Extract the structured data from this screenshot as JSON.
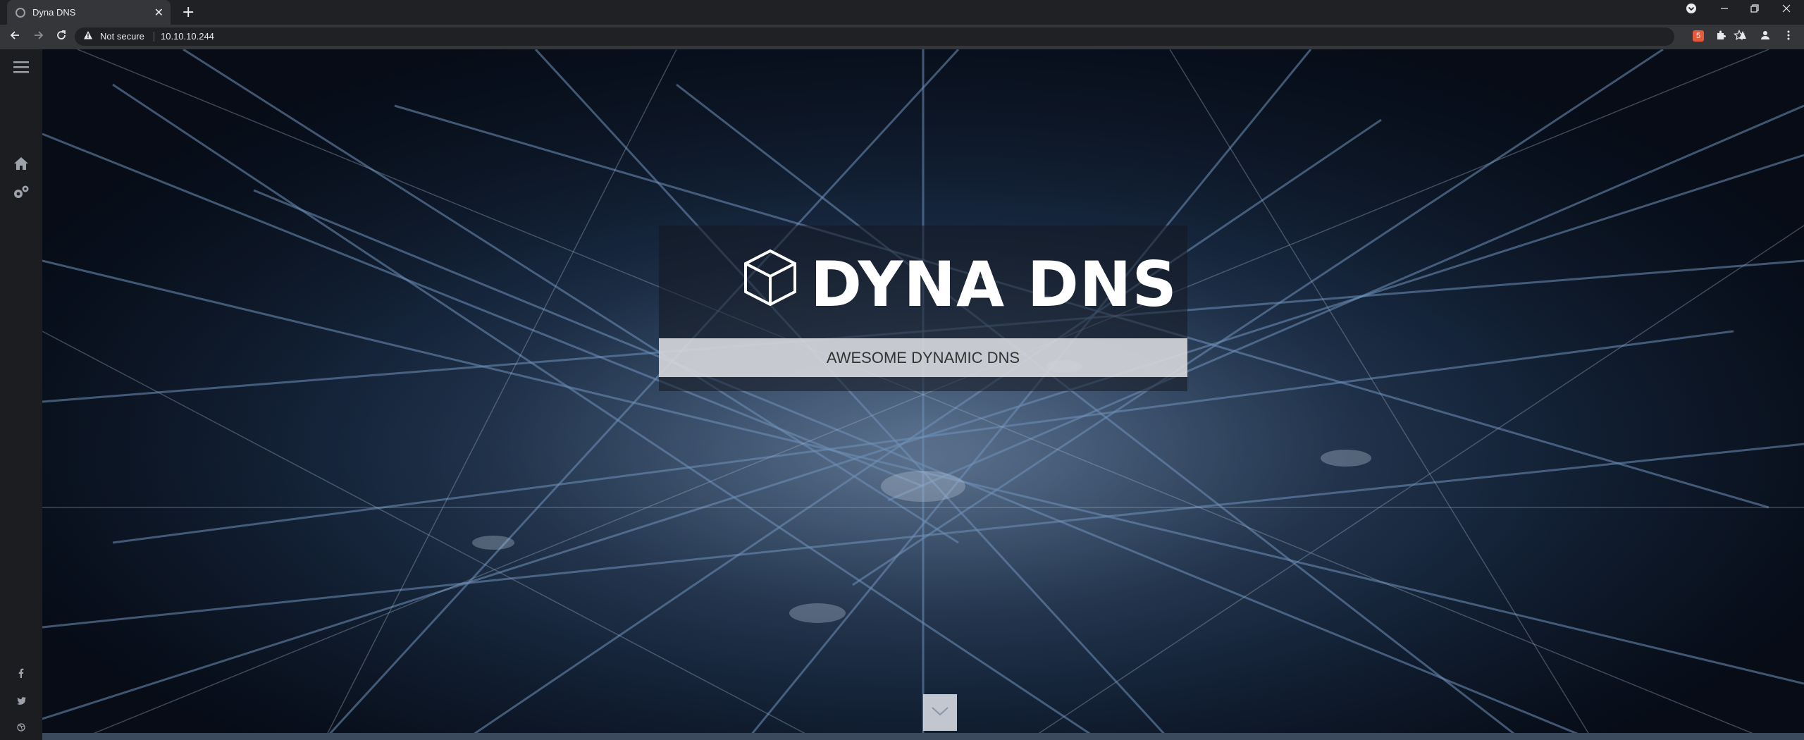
{
  "browser": {
    "tab_title": "Dyna DNS",
    "new_tab": "+",
    "close": "✕",
    "security_label": "Not secure",
    "url": "10.10.10.244"
  },
  "sidebar": {
    "menu_icon": "hamburger-menu-icon",
    "home_icon": "home-icon",
    "settings_icon": "gears-icon",
    "social": [
      "facebook-icon",
      "twitter-icon",
      "dribbble-icon"
    ]
  },
  "hero": {
    "title": "DYNA DNS",
    "tagline": "AWESOME DYNAMIC DNS",
    "logo_icon": "cube-icon",
    "scroll_icon": "chevron-down-icon"
  },
  "colors": {
    "chrome_bg": "#202124",
    "addrbar_bg": "#35363a",
    "sidebar_bg": "#1c1d20",
    "title_color": "#ffffff",
    "tagline_bg": "#ebecf0"
  }
}
